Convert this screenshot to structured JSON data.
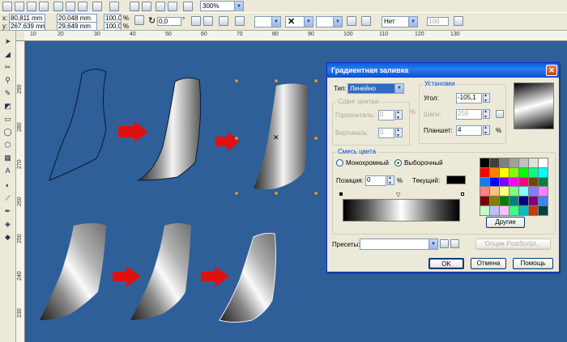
{
  "toolbar_top": {
    "zoom_value": "300%"
  },
  "property_bar": {
    "x_label": "x:",
    "x_value": "80,811 mm",
    "y_label": "y:",
    "y_value": "267,639 mm",
    "width_value": "20,048 mm",
    "height_value": "29,649 mm",
    "scale_w": "100,0",
    "scale_h": "100,0",
    "percent": "%",
    "rotation_value": "0,0",
    "degree_unit": "°",
    "outline_dropdown": "Нет",
    "outline_width": "100"
  },
  "rulers": {
    "horizontal_ticks": [
      "10",
      "20",
      "30",
      "40",
      "50",
      "60",
      "70",
      "80",
      "90",
      "100",
      "110",
      "120",
      "130"
    ],
    "vertical_ticks": [
      "290",
      "280",
      "270",
      "260",
      "250",
      "240",
      "230"
    ]
  },
  "dialog": {
    "title": "Градиентная заливка",
    "type_label": "Тип:",
    "type_value": "Линейно",
    "center_offset_group": "Сдвиг центра",
    "horizontal_label": "Горизонталь:",
    "horizontal_value": "0",
    "vertical_label": "Вертикаль:",
    "vertical_value": "0",
    "settings_group": "Установки",
    "angle_label": "Угол:",
    "angle_value": "-105,1",
    "steps_label": "Шаги:",
    "steps_value": "256",
    "edge_label": "Планшет:",
    "edge_value": "4",
    "percent": "%",
    "color_blend_group": "Смесь цвета",
    "mono_label": "Монохромный",
    "custom_label": "Выборочный",
    "position_label": "Позиция:",
    "position_value": "0",
    "current_label": "Текущий:",
    "other_button": "Другие",
    "presets_label": "Пресеты:",
    "postscript_button": "Опции PostScript...",
    "ok_button": "OK",
    "cancel_button": "Отмена",
    "help_button": "Помощь",
    "current_color": "#000000",
    "palette": [
      "#000000",
      "#404040",
      "#808080",
      "#a0a0a0",
      "#c0c0c0",
      "#e0e0e0",
      "#ffffff",
      "#ff0000",
      "#ff8000",
      "#ffff00",
      "#80ff00",
      "#00ff00",
      "#00ff80",
      "#00ffff",
      "#0080ff",
      "#0000ff",
      "#8000ff",
      "#ff00ff",
      "#ff0080",
      "#804000",
      "#008040",
      "#ff8080",
      "#ffc080",
      "#ffff80",
      "#80ff80",
      "#80ffff",
      "#8080ff",
      "#ff80ff",
      "#800000",
      "#808000",
      "#008000",
      "#008080",
      "#000080",
      "#800080",
      "#4080ff",
      "#c0ffc0",
      "#c0c0ff",
      "#ffc0ff",
      "#40ff80",
      "#00c0c0",
      "#c04000",
      "#004040"
    ]
  }
}
